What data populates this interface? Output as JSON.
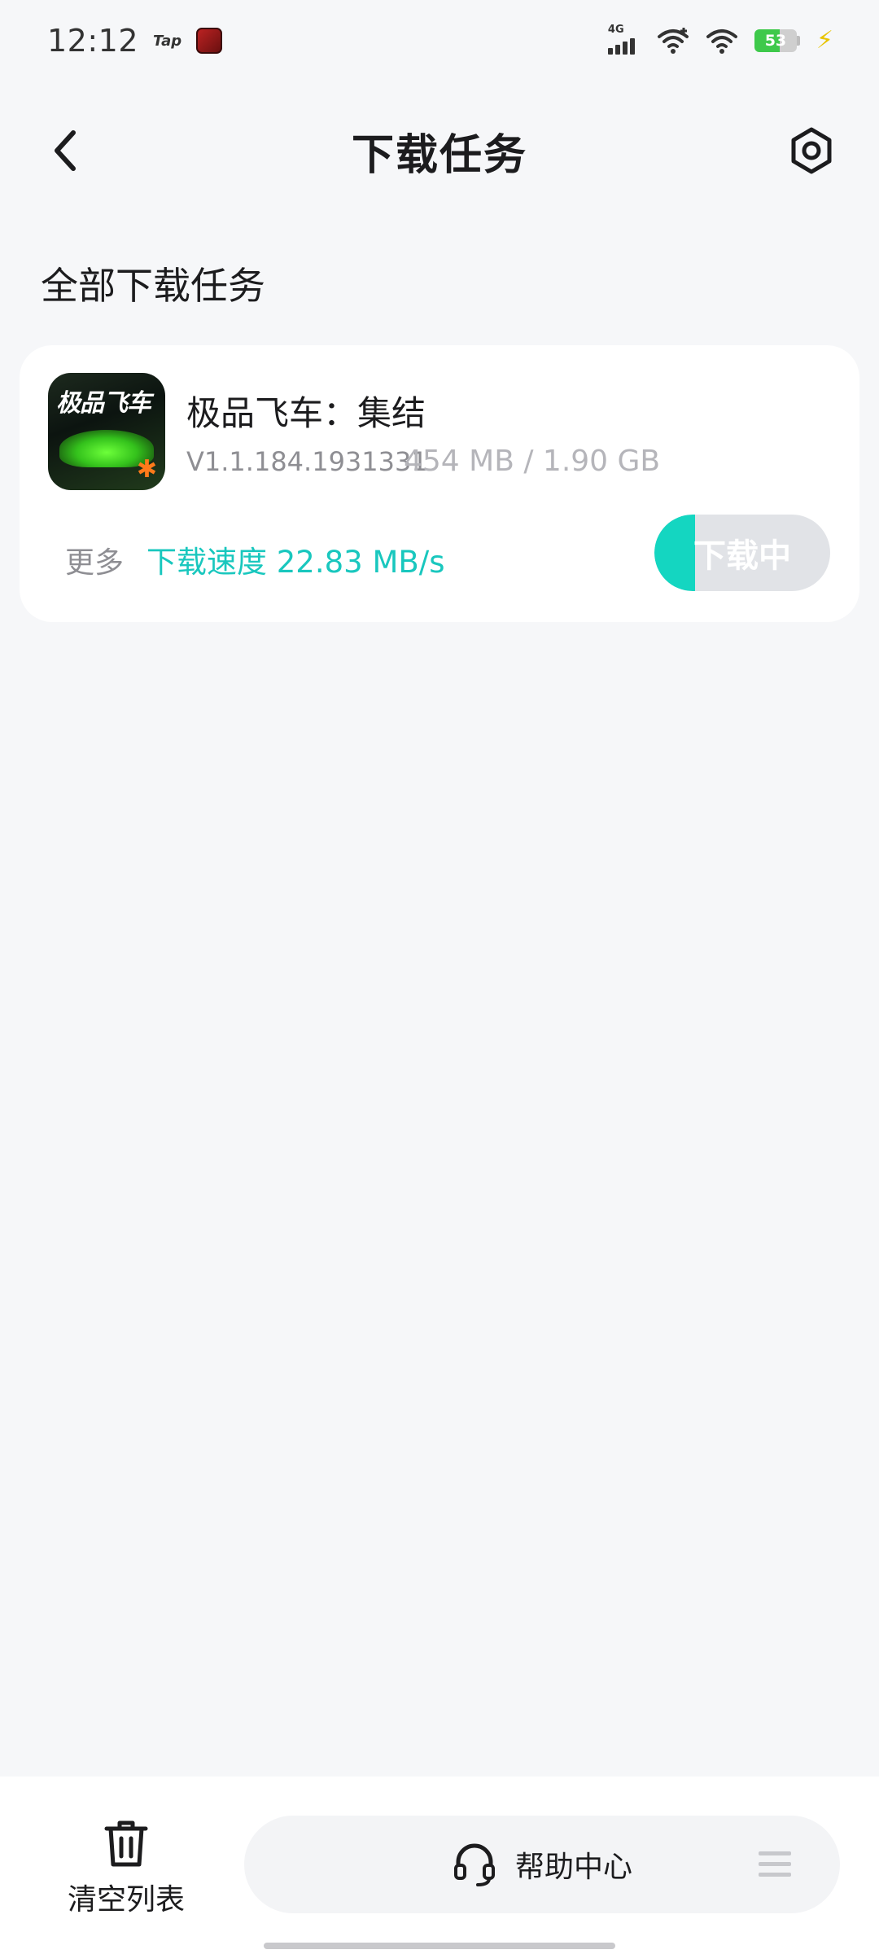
{
  "status_bar": {
    "time": "12:12",
    "tap_label": "Tap",
    "network_label": "4G",
    "battery_level": "53",
    "charging_icon": "lightning-icon"
  },
  "header": {
    "title": "下载任务",
    "back_icon": "chevron-left-icon",
    "settings_icon": "hexagon-settings-icon"
  },
  "section": {
    "title": "全部下载任务"
  },
  "download_item": {
    "name": "极品飞车：集结",
    "version": "V1.1.184.1931331",
    "size": "454 MB / 1.90 GB",
    "more_label": "更多",
    "speed": "下载速度 22.83 MB/s",
    "status_label": "下载中",
    "progress_fraction": 0.23,
    "icon_logo_text": "极品飞车",
    "accent_color": "#14d6c1"
  },
  "bottom_bar": {
    "clear_label": "清空列表",
    "clear_icon": "trash-icon",
    "help_label": "帮助中心",
    "help_icon": "headset-icon",
    "menu_icon": "menu-icon"
  }
}
